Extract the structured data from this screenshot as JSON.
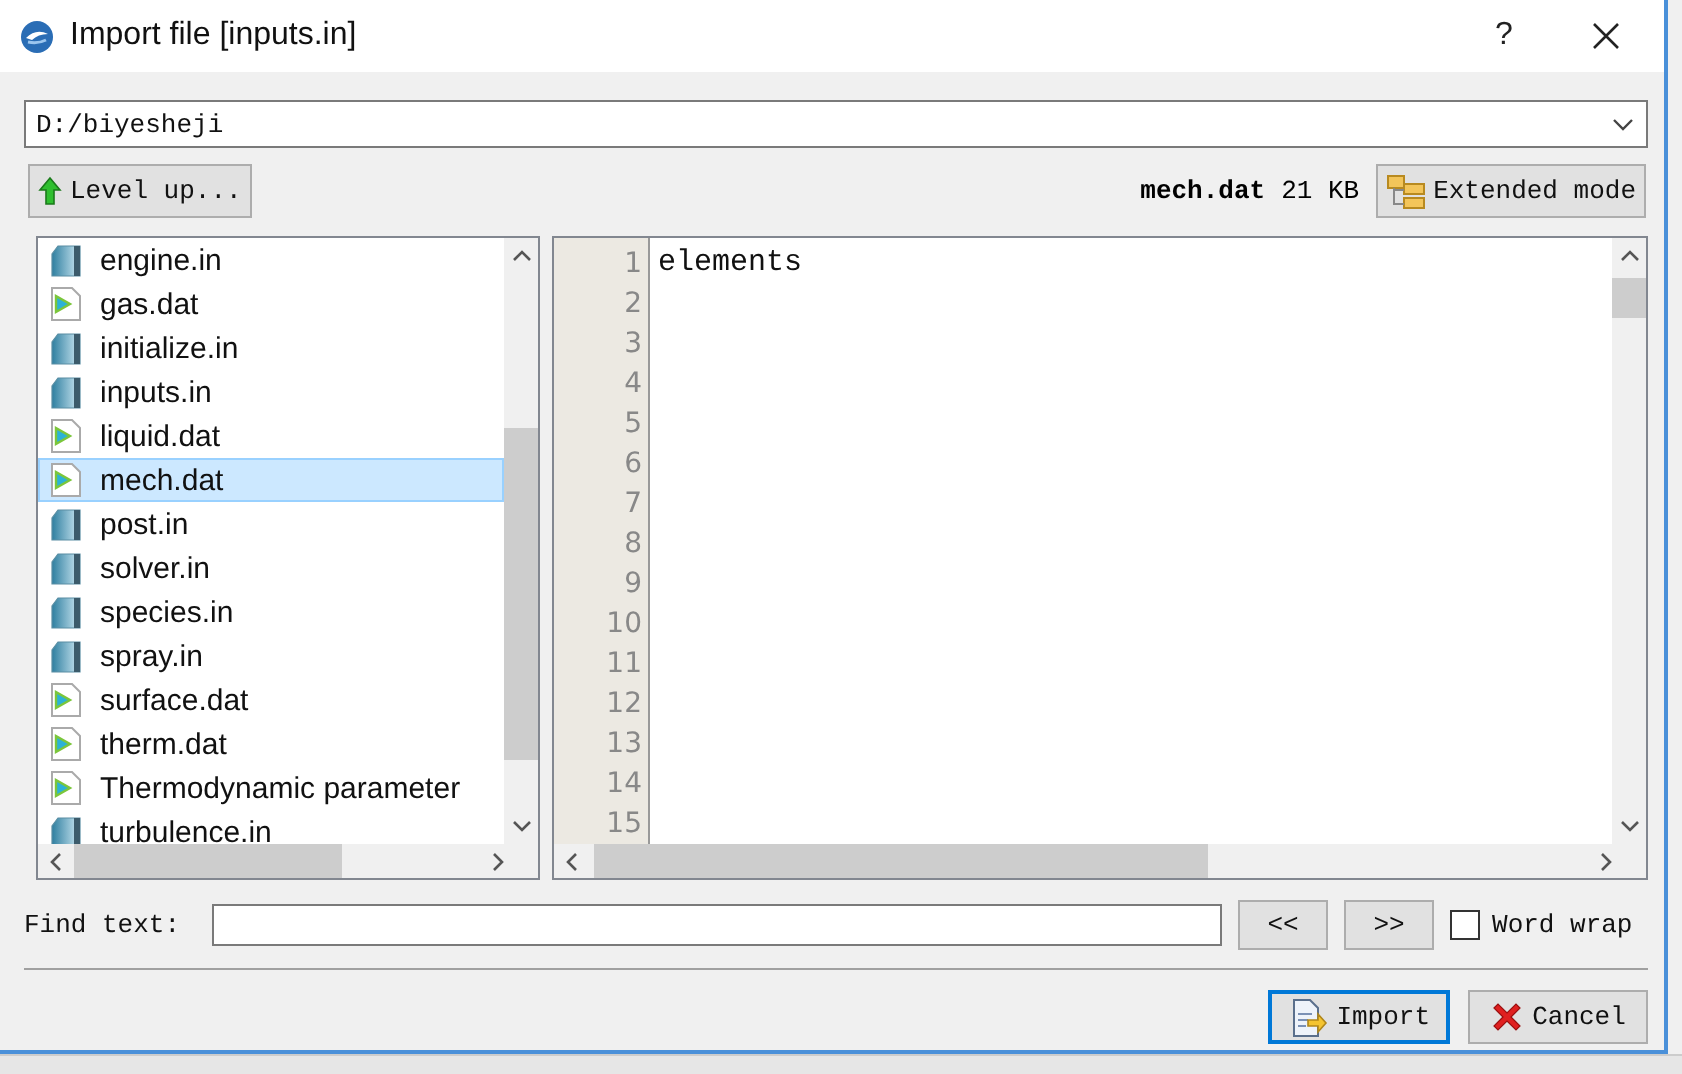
{
  "window": {
    "title": "Import file [inputs.in]",
    "help": "?"
  },
  "path": {
    "value": "D:/biyesheji"
  },
  "level_up": {
    "label": "Level up..."
  },
  "file_info": {
    "name": "mech.dat",
    "size": "21 KB"
  },
  "extended_mode": {
    "label": "Extended mode"
  },
  "files": [
    {
      "name": "engine.in",
      "kind": "input",
      "selected": false
    },
    {
      "name": "gas.dat",
      "kind": "data",
      "selected": false
    },
    {
      "name": "initialize.in",
      "kind": "input",
      "selected": false
    },
    {
      "name": "inputs.in",
      "kind": "input",
      "selected": false
    },
    {
      "name": "liquid.dat",
      "kind": "data",
      "selected": false
    },
    {
      "name": "mech.dat",
      "kind": "data",
      "selected": true
    },
    {
      "name": "post.in",
      "kind": "input",
      "selected": false
    },
    {
      "name": "solver.in",
      "kind": "input",
      "selected": false
    },
    {
      "name": "species.in",
      "kind": "input",
      "selected": false
    },
    {
      "name": "spray.in",
      "kind": "input",
      "selected": false
    },
    {
      "name": "surface.dat",
      "kind": "data",
      "selected": false
    },
    {
      "name": "therm.dat",
      "kind": "data",
      "selected": false
    },
    {
      "name": "Thermodynamic parameter",
      "kind": "data",
      "selected": false
    },
    {
      "name": "turbulence.in",
      "kind": "input",
      "selected": false
    }
  ],
  "editor": {
    "line_numbers": [
      "1",
      "2",
      "3",
      "4",
      "5",
      "6",
      "7",
      "8",
      "9",
      "10",
      "11",
      "12",
      "13",
      "14",
      "15"
    ],
    "lines": [
      "elements"
    ]
  },
  "find": {
    "label": "Find text:",
    "prev": "<<",
    "next": ">>",
    "word_wrap": {
      "label": "Word wrap",
      "checked": false
    }
  },
  "buttons": [
    {
      "label": "Import",
      "kind": "import",
      "default": true
    },
    {
      "label": "Cancel",
      "kind": "cancel",
      "default": false
    }
  ]
}
